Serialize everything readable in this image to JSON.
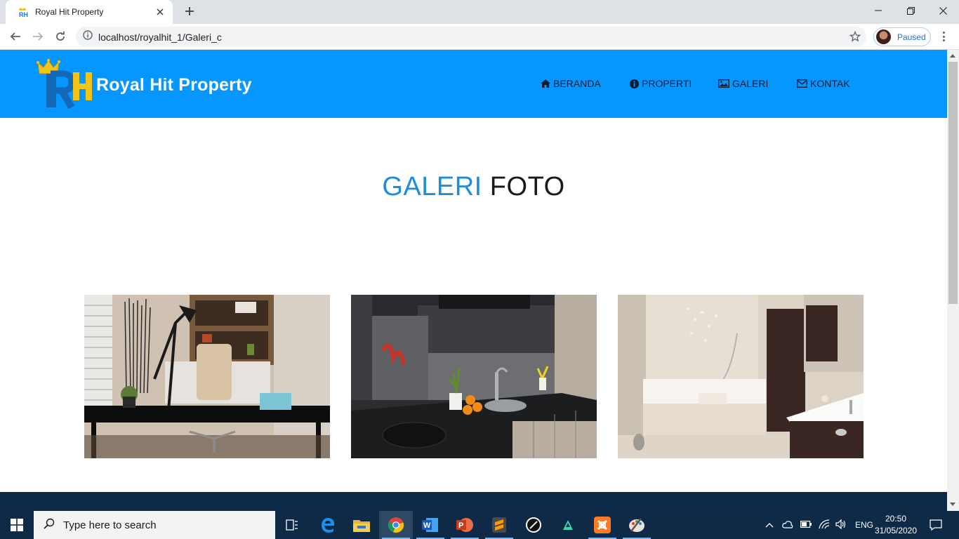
{
  "browser": {
    "tab_title": "Royal Hit Property",
    "url": "localhost/royalhit_1/Galeri_c",
    "profile_status": "Paused"
  },
  "site": {
    "brand": "Royal Hit Property",
    "logo_letters": "RH",
    "nav": [
      {
        "label": "BERANDA",
        "icon": "home-icon"
      },
      {
        "label": "PROPERTI",
        "icon": "info-circle-icon"
      },
      {
        "label": "GALERI",
        "icon": "image-icon"
      },
      {
        "label": "KONTAK",
        "icon": "envelope-icon"
      }
    ],
    "heading_highlight": "GALERI",
    "heading_rest": "FOTO",
    "gallery": [
      {
        "name": "office-photo"
      },
      {
        "name": "kitchen-photo"
      },
      {
        "name": "bathroom-photo"
      }
    ],
    "colors": {
      "header_bg": "#0596ff",
      "heading_accent": "#1c8ddf",
      "footer_bg": "#0e2a49"
    }
  },
  "taskbar": {
    "search_placeholder": "Type here to search",
    "language": "ENG",
    "time": "20:50",
    "date": "31/05/2020",
    "apps": [
      "task-view-icon",
      "edge-icon",
      "file-explorer-icon",
      "chrome-icon",
      "word-icon",
      "powerpoint-icon",
      "sublime-text-icon",
      "inkscape-icon",
      "filmora-icon",
      "xampp-icon",
      "paint-icon"
    ]
  }
}
